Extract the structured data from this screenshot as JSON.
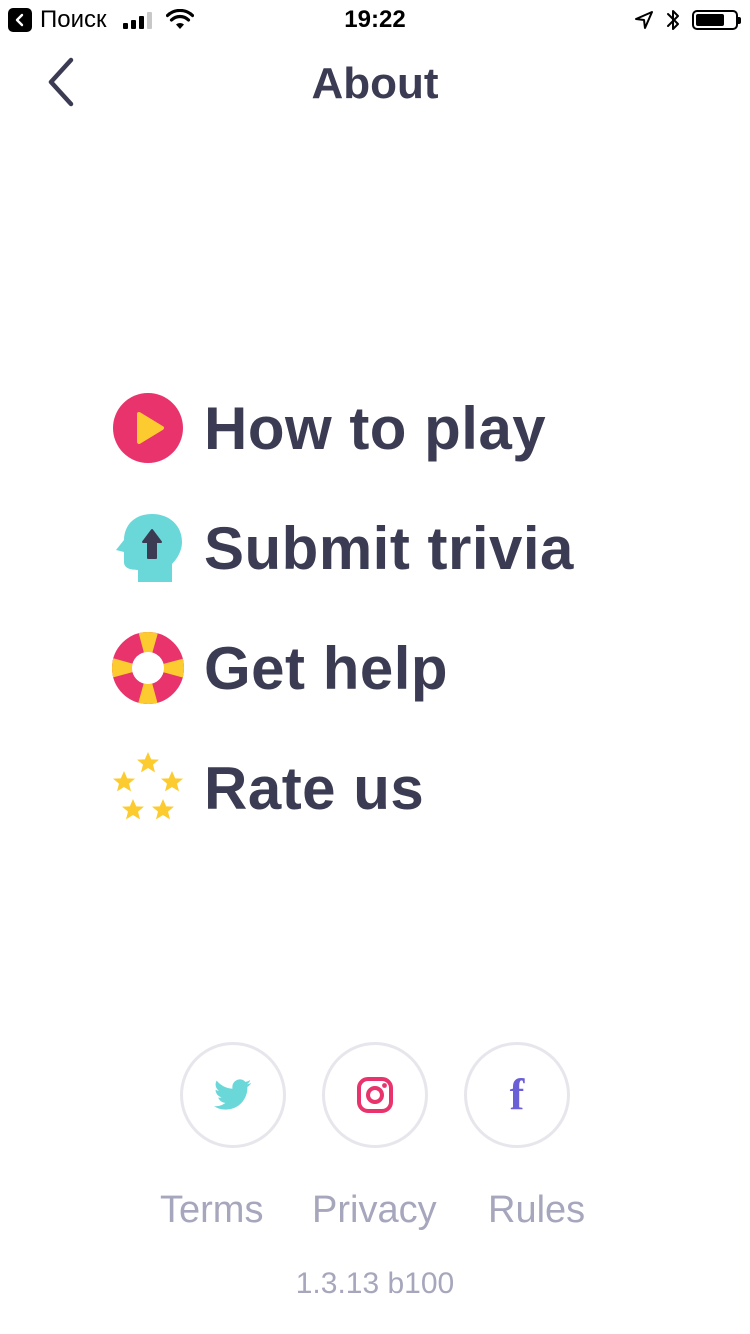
{
  "status_bar": {
    "back_app_label": "Поиск",
    "time": "19:22",
    "signal_bars": 3,
    "signal_bars_total": 4,
    "battery_level": 0.7
  },
  "header": {
    "title": "About"
  },
  "menu": {
    "items": [
      {
        "label": "How to play",
        "icon": "play-icon"
      },
      {
        "label": "Submit trivia",
        "icon": "head-upload-icon"
      },
      {
        "label": "Get help",
        "icon": "lifebuoy-icon"
      },
      {
        "label": "Rate us",
        "icon": "stars-icon"
      }
    ]
  },
  "social": {
    "twitter_icon": "twitter-icon",
    "instagram_icon": "instagram-icon",
    "facebook_icon": "facebook-icon",
    "facebook_glyph": "f"
  },
  "footer": {
    "terms": "Terms",
    "privacy": "Privacy",
    "rules": "Rules",
    "version": "1.3.13 b100"
  },
  "colors": {
    "text_dark": "#3b3b53",
    "text_muted": "#a6a6bd",
    "accent_pink": "#e8336c",
    "accent_yellow": "#fccb2f",
    "accent_teal": "#6ad7d9",
    "accent_purple": "#6a5fd6",
    "circle_border": "#e6e6ec"
  }
}
